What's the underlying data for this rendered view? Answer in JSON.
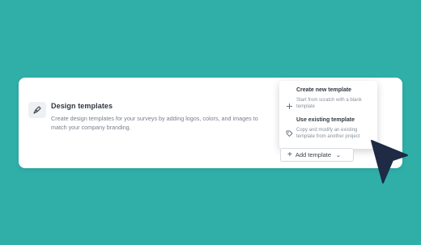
{
  "card": {
    "title": "Design templates",
    "description": "Create design templates for your surveys by adding logos, colors, and images to match your company branding."
  },
  "dropdown": {
    "items": [
      {
        "icon": "plus-icon",
        "title": "Create new template",
        "description": "Start from scratch with a blank template"
      },
      {
        "icon": "tag-icon",
        "title": "Use existing template",
        "description": "Copy and modify an existing template from another project"
      }
    ]
  },
  "add_button": {
    "plus": "+",
    "label": "Add template",
    "chevron": "⌄"
  },
  "colors": {
    "background": "#2fafa8",
    "cursor": "#1f2a44"
  }
}
